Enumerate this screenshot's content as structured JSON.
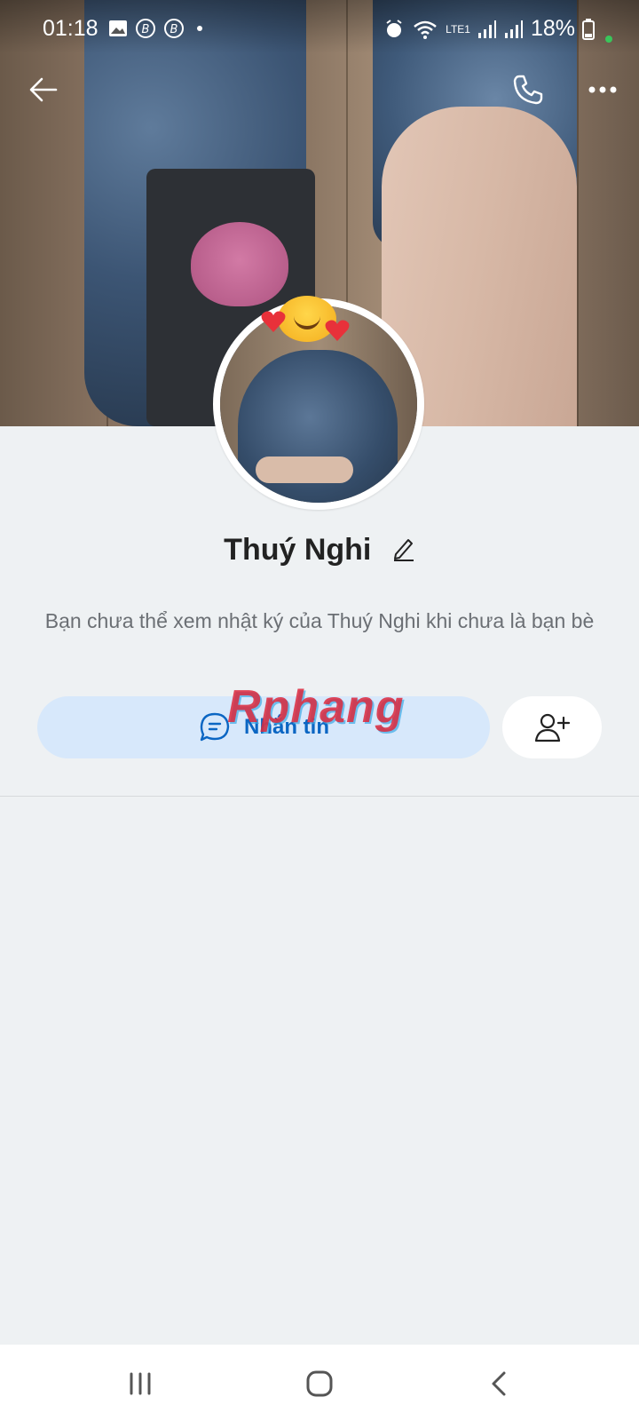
{
  "status_bar": {
    "time": "01:18",
    "battery": "18%",
    "network": "LTE1"
  },
  "profile": {
    "name": "Thuý Nghi",
    "notice": "Bạn chưa thể xem nhật ký của Thuý Nghi khi chưa là bạn bè"
  },
  "actions": {
    "message_label": "Nhắn tin"
  },
  "watermark": "Rphang",
  "icons": {
    "back": "arrow-left",
    "call": "phone",
    "more": "ellipsis",
    "edit": "pencil",
    "message": "chat-bubble",
    "add_friend": "user-plus"
  },
  "colors": {
    "accent": "#0b66c3",
    "message_button_bg": "#d7e8fb",
    "page_bg": "#eef1f3"
  }
}
